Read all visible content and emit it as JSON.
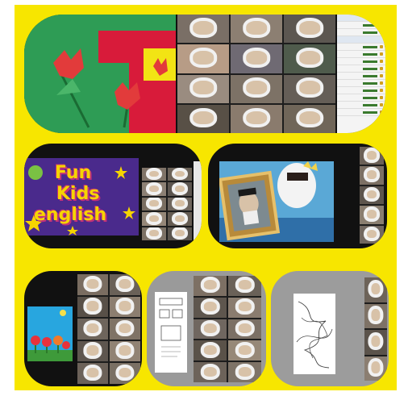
{
  "collage": {
    "background_color": "#f7e600",
    "panel_count": 6
  },
  "panel_1": {
    "topic": "paper tulip craft",
    "colors": {
      "green": "#2e9c55",
      "red": "#d81b3a",
      "yellow": "#f2e414"
    },
    "participants": 12
  },
  "panel_2": {
    "title_line1": "Fun",
    "title_line2": "Kids",
    "title_line3": "english",
    "participants": 10
  },
  "panel_3": {
    "topic": "animated portrait scene",
    "participants": 5
  },
  "panel_4": {
    "topic": "flower garden drawing",
    "participants": 10
  },
  "panel_5": {
    "topic": "worksheet",
    "participants": 10
  },
  "panel_6": {
    "topic": "scribble drawing",
    "participants": 4
  }
}
